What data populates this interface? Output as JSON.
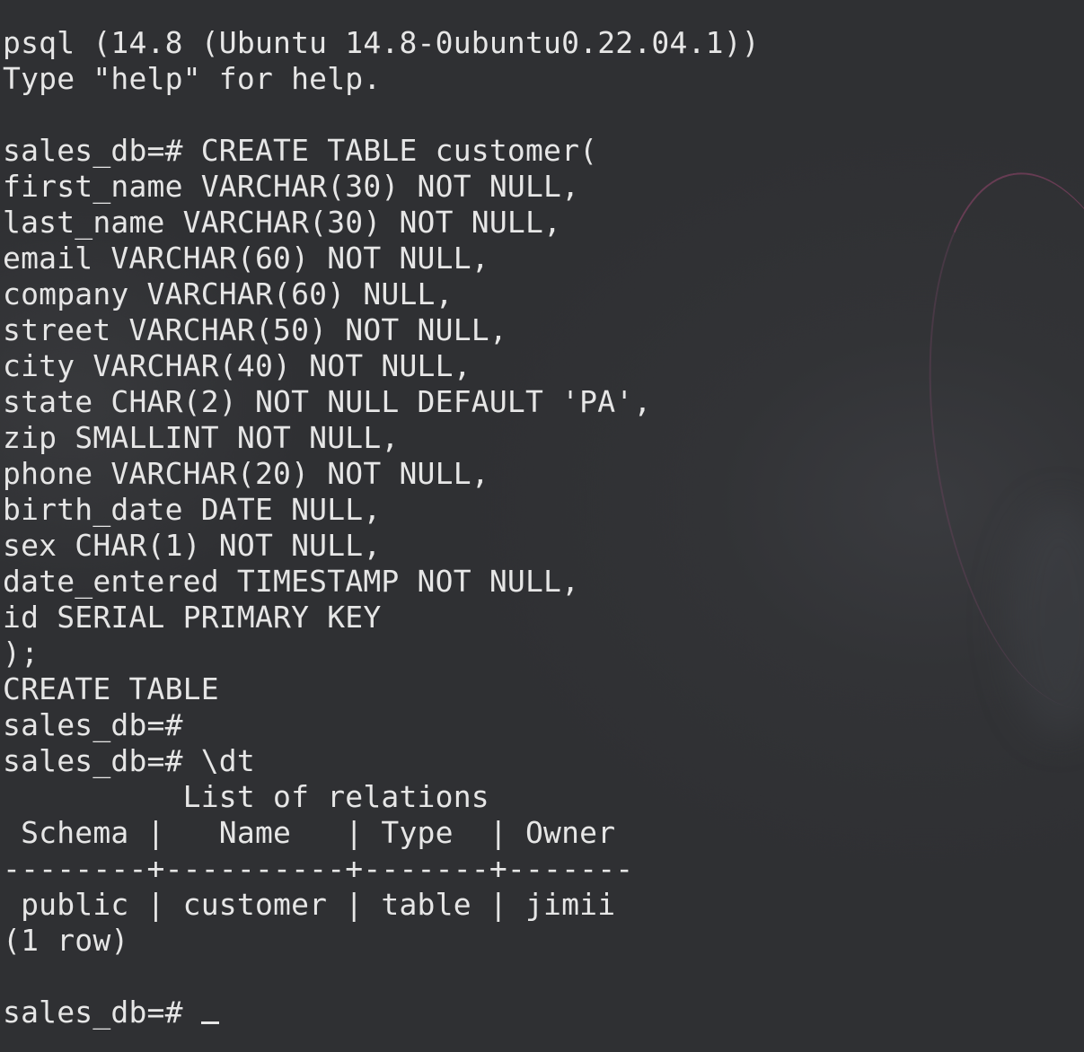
{
  "terminal": {
    "lines": [
      "psql (14.8 (Ubuntu 14.8-0ubuntu0.22.04.1))",
      "Type \"help\" for help.",
      "",
      "sales_db=# CREATE TABLE customer(",
      "first_name VARCHAR(30) NOT NULL,",
      "last_name VARCHAR(30) NOT NULL,",
      "email VARCHAR(60) NOT NULL,",
      "company VARCHAR(60) NULL,",
      "street VARCHAR(50) NOT NULL,",
      "city VARCHAR(40) NOT NULL,",
      "state CHAR(2) NOT NULL DEFAULT 'PA',",
      "zip SMALLINT NOT NULL,",
      "phone VARCHAR(20) NOT NULL,",
      "birth_date DATE NULL,",
      "sex CHAR(1) NOT NULL,",
      "date_entered TIMESTAMP NOT NULL,",
      "id SERIAL PRIMARY KEY",
      ");",
      "CREATE TABLE",
      "sales_db=#",
      "sales_db=# \\dt",
      "          List of relations",
      " Schema |   Name   | Type  | Owner",
      "--------+----------+-------+-------",
      " public | customer | table | jimii",
      "(1 row)",
      ""
    ],
    "prompt": "sales_db=# "
  },
  "colors": {
    "background": "#2f3033",
    "text": "#e6e6e6"
  }
}
